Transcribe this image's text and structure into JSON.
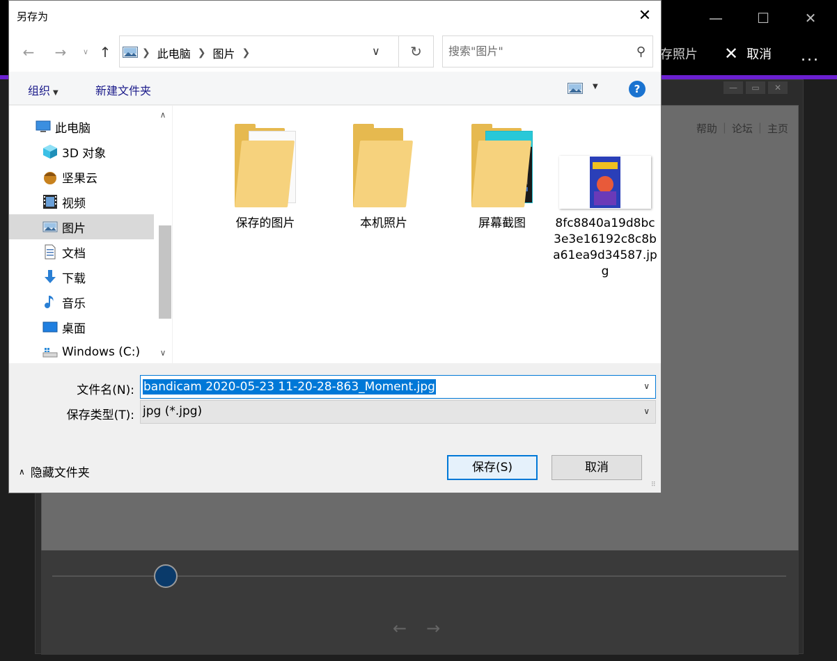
{
  "background_app": {
    "save_photo_label": "存照片",
    "cancel_label": "取消",
    "more_label": "...",
    "links": [
      "帮助",
      "论坛",
      "主页"
    ]
  },
  "dialog": {
    "title": "另存为",
    "close_label": "✕",
    "address": {
      "crumbs": [
        "此电脑",
        "图片"
      ]
    },
    "search": {
      "placeholder": "搜索\"图片\""
    },
    "toolbar": {
      "organize_label": "组织",
      "new_folder_label": "新建文件夹",
      "help_label": "?"
    },
    "nav_items": [
      {
        "label": "此电脑",
        "icon": "computer-icon"
      },
      {
        "label": "3D 对象",
        "icon": "cube-icon"
      },
      {
        "label": "坚果云",
        "icon": "nut-icon"
      },
      {
        "label": "视频",
        "icon": "film-icon"
      },
      {
        "label": "图片",
        "icon": "picture-icon",
        "selected": true
      },
      {
        "label": "文档",
        "icon": "document-icon"
      },
      {
        "label": "下载",
        "icon": "download-icon"
      },
      {
        "label": "音乐",
        "icon": "music-icon"
      },
      {
        "label": "桌面",
        "icon": "desktop-icon"
      },
      {
        "label": "Windows (C:)",
        "icon": "drive-icon"
      }
    ],
    "files": [
      {
        "label": "保存的图片",
        "type": "folder"
      },
      {
        "label": "本机照片",
        "type": "folder"
      },
      {
        "label": "屏幕截图",
        "type": "folder"
      },
      {
        "label": "8fc8840a19d8bc3e3e16192c8c8ba61ea9d34587.jpg",
        "type": "image"
      }
    ],
    "filename": {
      "label": "文件名(N):",
      "value": "bandicam 2020-05-23 11-20-28-863_Moment.jpg"
    },
    "filetype": {
      "label": "保存类型(T):",
      "value": "jpg (*.jpg)"
    },
    "hide_folders_label": "隐藏文件夹",
    "save_label": "保存(S)",
    "cancel_label": "取消",
    "colors": {
      "accent": "#0078d7",
      "selection_bg": "#d9d9d9",
      "folder_yellow": "#f6d27d"
    }
  }
}
